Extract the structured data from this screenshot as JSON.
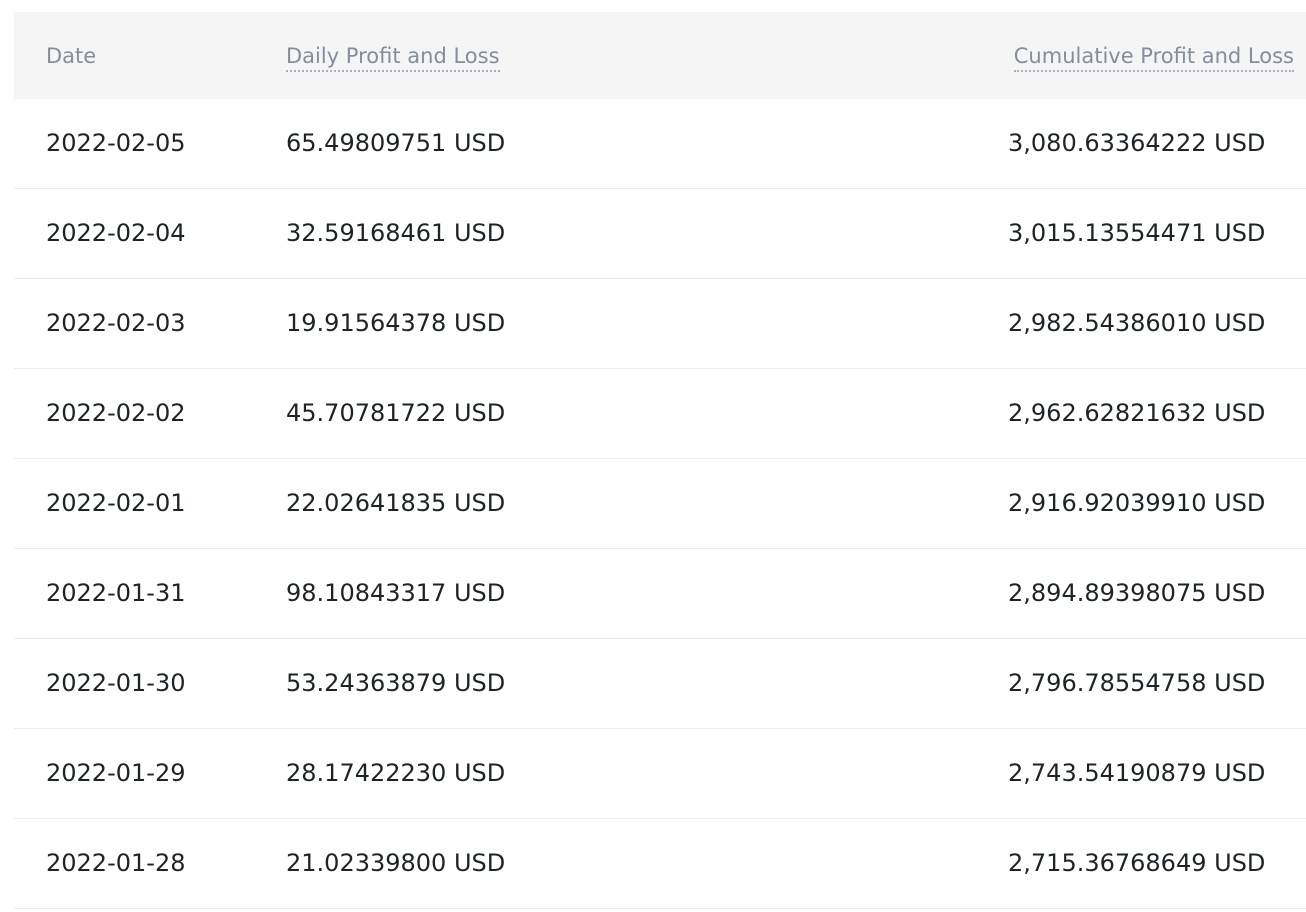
{
  "table": {
    "headers": {
      "date": "Date",
      "daily": "Daily Profit and Loss",
      "cumulative": "Cumulative Profit and Loss"
    },
    "rows": [
      {
        "date": "2022-02-05",
        "daily": "65.49809751 USD",
        "cumulative": "3,080.63364222 USD"
      },
      {
        "date": "2022-02-04",
        "daily": "32.59168461 USD",
        "cumulative": "3,015.13554471 USD"
      },
      {
        "date": "2022-02-03",
        "daily": "19.91564378 USD",
        "cumulative": "2,982.54386010 USD"
      },
      {
        "date": "2022-02-02",
        "daily": "45.70781722 USD",
        "cumulative": "2,962.62821632 USD"
      },
      {
        "date": "2022-02-01",
        "daily": "22.02641835 USD",
        "cumulative": "2,916.92039910 USD"
      },
      {
        "date": "2022-01-31",
        "daily": "98.10843317 USD",
        "cumulative": "2,894.89398075 USD"
      },
      {
        "date": "2022-01-30",
        "daily": "53.24363879 USD",
        "cumulative": "2,796.78554758 USD"
      },
      {
        "date": "2022-01-29",
        "daily": "28.17422230 USD",
        "cumulative": "2,743.54190879 USD"
      },
      {
        "date": "2022-01-28",
        "daily": "21.02339800 USD",
        "cumulative": "2,715.36768649 USD"
      }
    ]
  }
}
